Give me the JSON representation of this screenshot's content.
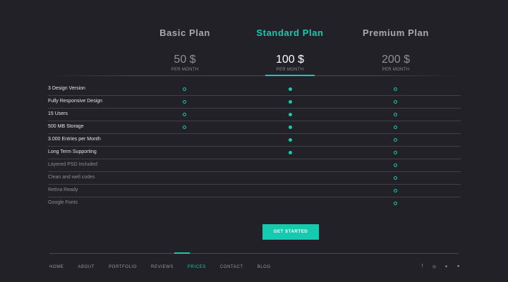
{
  "colors": {
    "accent": "#16cab0",
    "background": "#222127",
    "muted": "#8c8b92"
  },
  "plans": [
    {
      "name": "Basic Plan",
      "price": "50 $",
      "period": "PER MONTH",
      "name_color": "#a9a9ae",
      "price_color": "#8f8f95"
    },
    {
      "name": "Standard Plan",
      "price": "100 $",
      "period": "PER MONTH",
      "name_color": "#16cab0",
      "price_color": "#ffffff"
    },
    {
      "name": "Premium Plan",
      "price": "200 $",
      "period": "PER MONTH",
      "name_color": "#a9a9ae",
      "price_color": "#8f8f95"
    }
  ],
  "features": [
    {
      "label": "3 Design Version",
      "dim": false,
      "marks": [
        "ring",
        "dot",
        "ring"
      ]
    },
    {
      "label": "Fully Responsive Design",
      "dim": false,
      "marks": [
        "ring",
        "dot",
        "ring"
      ]
    },
    {
      "label": "15 Users",
      "dim": false,
      "marks": [
        "ring",
        "dot",
        "ring"
      ]
    },
    {
      "label": "500 MB Storage",
      "dim": false,
      "marks": [
        "ring",
        "dot",
        "ring"
      ]
    },
    {
      "label": "3.000 Entries per Month",
      "dim": false,
      "marks": [
        "",
        "dot",
        "ring"
      ]
    },
    {
      "label": "Long Term Supporting",
      "dim": false,
      "marks": [
        "",
        "dot",
        "ring"
      ]
    },
    {
      "label": "Layered PSD Included",
      "dim": true,
      "marks": [
        "",
        "",
        "ring"
      ]
    },
    {
      "label": "Clean and well codes",
      "dim": true,
      "marks": [
        "",
        "",
        "ring"
      ]
    },
    {
      "label": "Retina Ready",
      "dim": true,
      "marks": [
        "",
        "",
        "ring"
      ]
    },
    {
      "label": "Google Fonts",
      "dim": true,
      "marks": [
        "",
        "",
        "ring"
      ]
    }
  ],
  "cta_label": "GET STARTED",
  "nav": {
    "items": [
      "HOME",
      "ABOUT",
      "PORTFOLIO",
      "REVIEWS",
      "PRICES",
      "CONTACT",
      "BLOG"
    ],
    "active": "PRICES"
  },
  "social": [
    {
      "name": "facebook-icon",
      "glyph": "f"
    },
    {
      "name": "instagram-icon",
      "glyph": "◎"
    },
    {
      "name": "twitter-icon",
      "glyph": "✦"
    },
    {
      "name": "dribbble-icon",
      "glyph": "●"
    }
  ]
}
